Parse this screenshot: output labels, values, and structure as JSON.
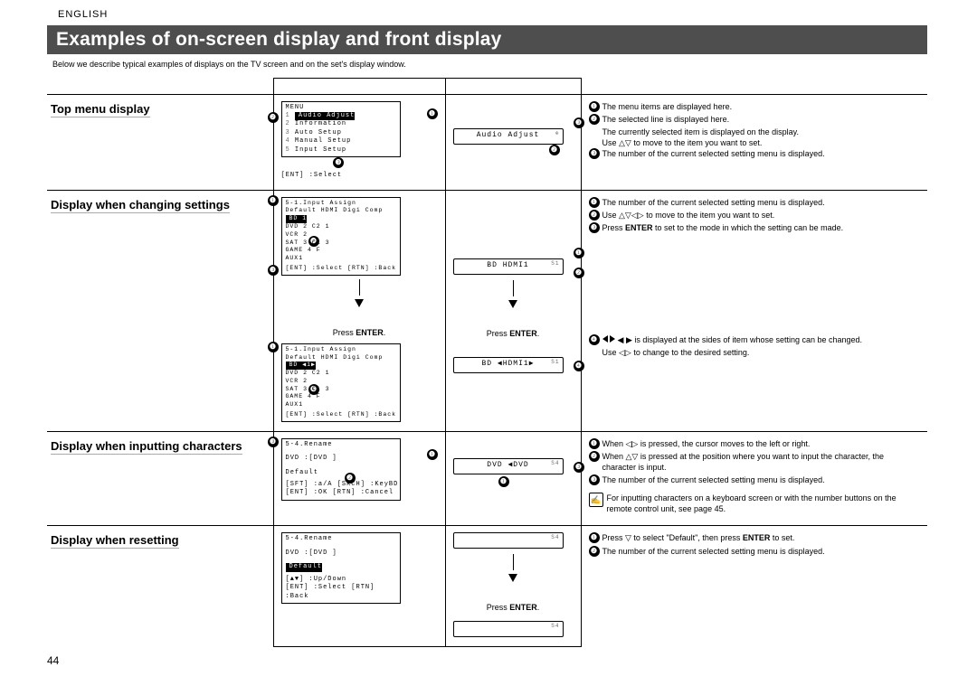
{
  "lang": "ENGLISH",
  "title": "Examples of on-screen display and front display",
  "intro": "Below we describe typical examples of displays on the TV screen and on the set's display window.",
  "page_number": "44",
  "labels": {
    "top": "Top menu display",
    "change": "Display when changing settings",
    "input_chars": "Display when inputting characters",
    "reset": "Display when resetting"
  },
  "press_enter": "Press ENTER.",
  "osd": {
    "menu": {
      "title": "MENU",
      "items": [
        "Audio Adjust",
        "Information",
        "Auto Setup",
        "Manual Setup",
        "Input Setup"
      ],
      "footer": "[ENT] :Select"
    },
    "assign1": {
      "title": "5-1.Input Assign",
      "header": "Default  HDMI  Digi  Comp",
      "rows": [
        [
          "BD",
          "1",
          "",
          ""
        ],
        [
          "DVD",
          "2",
          "C2",
          "1"
        ],
        [
          "VCR",
          "",
          "",
          "2"
        ],
        [
          "SAT",
          "3",
          "C1",
          "3"
        ],
        [
          "GAME",
          "4",
          "F",
          ""
        ],
        [
          "AUX1",
          "",
          "",
          ""
        ]
      ],
      "footer": "[ENT] :Select   [RTN] :Back"
    },
    "rename1": {
      "title": "5-4.Rename",
      "line1": "DVD      :[DVD       ]",
      "line2": "Default",
      "footer1": "[SFT] :a/A   [SRCH] :KeyBD",
      "footer2": "[ENT] :OK    [RTN] :Cancel"
    },
    "rename2": {
      "title": "5-4.Rename",
      "line1": "DVD      :[DVD       ]",
      "hl": "Default",
      "footer1": "[▲▼] :Up/Down",
      "footer2": "[ENT] :Select  [RTN] :Back"
    }
  },
  "vfd": {
    "top": "Audio Adjust",
    "change1": "BD   HDMI1",
    "change2": "BD   ◀HDMI1▶",
    "input": "DVD   ◀DVD    "
  },
  "notes": {
    "top": [
      "The menu items are displayed here.",
      "The selected line is displayed here.",
      "The number of the current selected setting menu is displayed."
    ],
    "top_extra": [
      "The currently selected item is displayed on the display.",
      "Use △▽ to move to the item you want to set."
    ],
    "change": [
      "The number of the current selected setting menu is displayed.",
      "Use △▽◁▷ to move to the item you want to set.",
      "Press ENTER to set to the mode in which the setting can be made."
    ],
    "change4a": "◀ ▶ is displayed at the sides of item whose setting can be changed.",
    "change4b": "Use ◁▷ to change to the desired setting.",
    "input": [
      "When ◁▷ is pressed, the cursor moves to the left or right.",
      "When △▽ is pressed at the position where you want to input the character, the character is input.",
      "The number of the current selected setting menu is displayed."
    ],
    "input_hand": "For inputting characters on a keyboard screen or with the number buttons on the remote control unit, see page 45.",
    "reset": [
      "Press ▽ to select \"Default\", then press ENTER to set.",
      "The number of the current selected setting menu is displayed."
    ]
  }
}
